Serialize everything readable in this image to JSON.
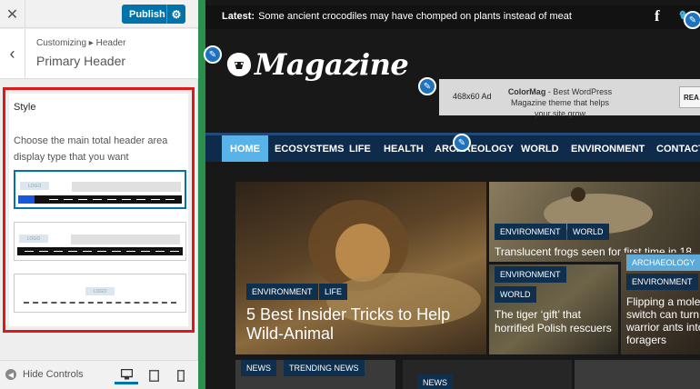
{
  "customizer": {
    "close_icon": "close-icon",
    "publish_label": "Publish",
    "breadcrumb": "Customizing ▸ Header",
    "title": "Primary Header",
    "section_title": "Style",
    "description": "Choose the main total header area display type that you want",
    "options": [
      "header-style-1",
      "header-style-2",
      "header-style-3"
    ],
    "option_logo_text": "LOGO",
    "hide_controls": "Hide Controls",
    "accent": "#0073aa",
    "highlight_border": "#dd1a1a"
  },
  "preview": {
    "latest_label": "Latest:",
    "latest_text": "Some ancient crocodiles may have chomped on plants instead of meat",
    "logo_text": "Magazine",
    "ad": {
      "label": "468x60 Ad",
      "title": "ColorMag",
      "text": " - Best WordPress Magazine theme that helps your site grow",
      "button": "REA"
    },
    "nav": [
      "HOME",
      "ECOSYSTEMS",
      "LIFE",
      "HEALTH",
      "ARCHAEOLOGY",
      "WORLD",
      "ENVIRONMENT",
      "CONTACT"
    ],
    "featured": {
      "tags": [
        "ENVIRONMENT",
        "LIFE"
      ],
      "title_line1": "5 Best Insider Tricks to Help",
      "title_line2": "Wild-Animal"
    },
    "frogs": {
      "tags": [
        "ENVIRONMENT",
        "WORLD"
      ],
      "title": "Translucent frogs seen for first time in 18"
    },
    "gift": {
      "tags": [
        "ENVIRONMENT",
        "WORLD"
      ],
      "title": "The tiger ‘gift’ that horrified Polish rescuers"
    },
    "ants": {
      "tags": [
        "ARCHAEOLOGY",
        "ENVIRONMENT"
      ],
      "title": "Flipping a moleс switch can turn warrior ants into foragers"
    },
    "bottom": {
      "tags": [
        "NEWS",
        "TRENDING NEWS"
      ],
      "tag2": "NEWS"
    },
    "nav_color": "#0e2b4b",
    "active_nav_color": "#58b4e8",
    "frame_color": "#2a8f4c"
  }
}
